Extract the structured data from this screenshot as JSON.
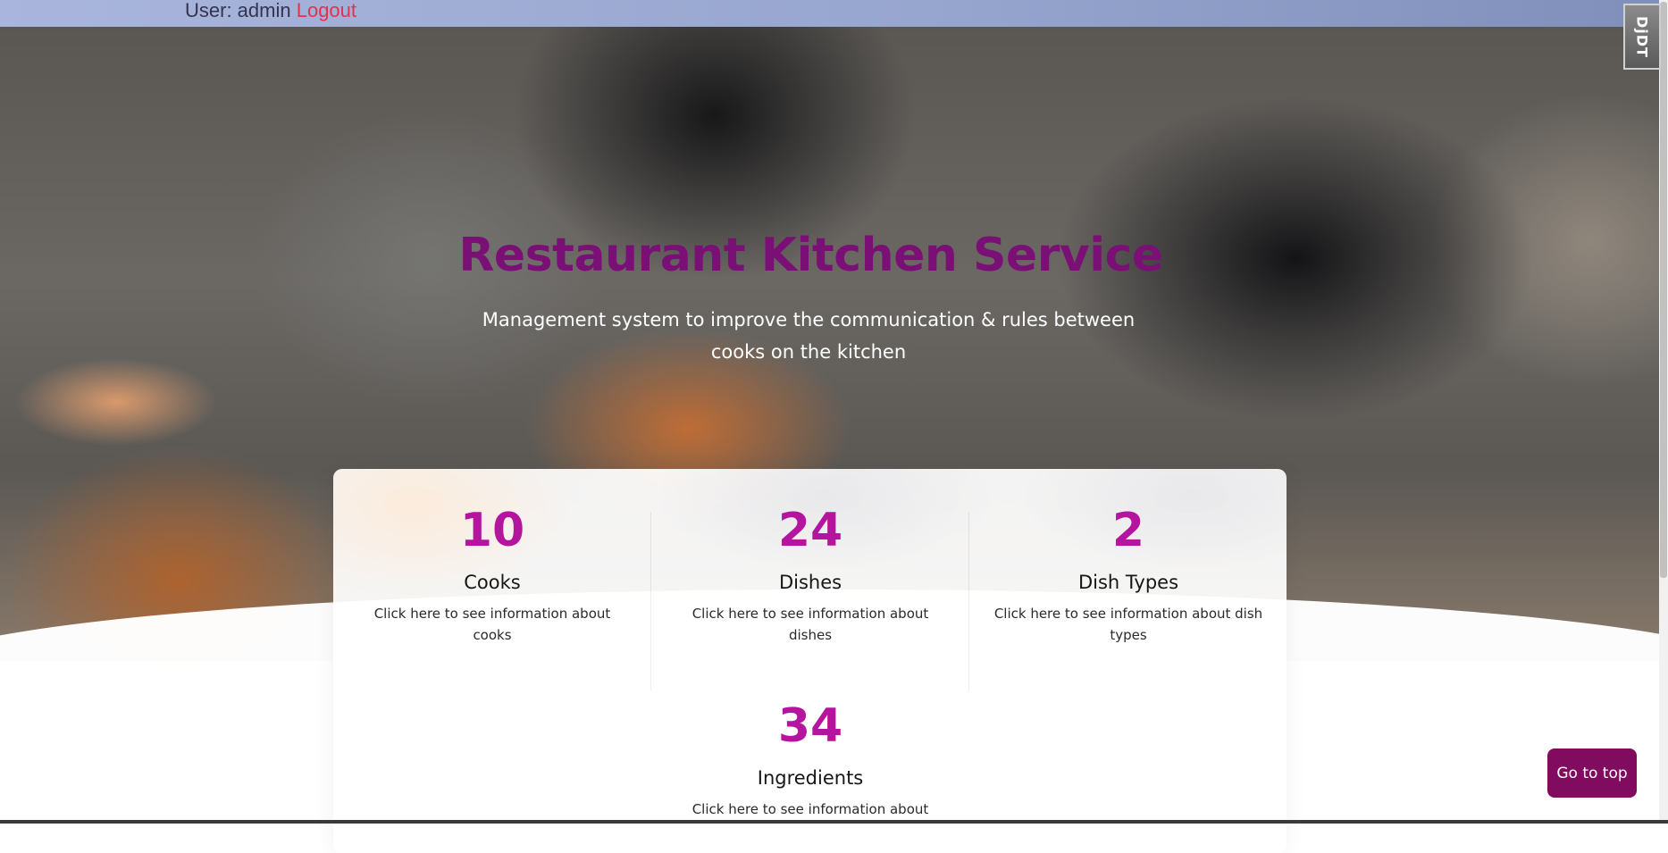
{
  "topbar": {
    "user_text": "User: admin",
    "logout_label": "Logout"
  },
  "hero": {
    "title": "Restaurant Kitchen Service",
    "subtitle": "Management system to improve the communication & rules between cooks on the kitchen"
  },
  "stats": [
    {
      "value": "10",
      "label": "Cooks",
      "description": "Click here to see information about cooks"
    },
    {
      "value": "24",
      "label": "Dishes",
      "description": "Click here to see information about dishes"
    },
    {
      "value": "2",
      "label": "Dish Types",
      "description": "Click here to see information about dish types"
    },
    {
      "value": "34",
      "label": "Ingredients",
      "description": "Click here to see information about"
    }
  ],
  "go_top_label": "Go to top",
  "debug_toolbar_label": "DjDT",
  "colors": {
    "title": "#7a1075",
    "stat_number": "#b4149e",
    "button": "#800b5f",
    "logout": "#e2324f"
  }
}
